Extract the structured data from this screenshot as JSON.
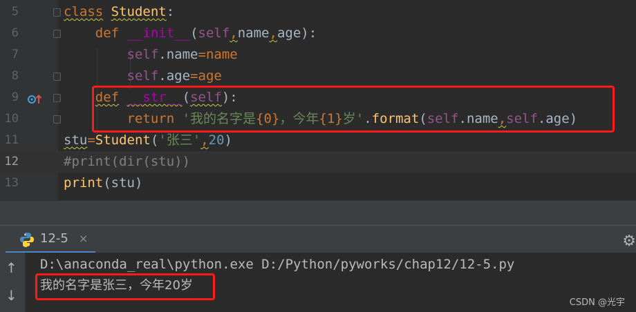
{
  "editor": {
    "line_numbers": [
      "5",
      "6",
      "7",
      "8",
      "9",
      "10",
      "11",
      "12",
      "13"
    ],
    "code": {
      "l5": {
        "kw": "class",
        "name": "Student",
        "colon": ":"
      },
      "l6": {
        "kw": "def",
        "name": "__init__",
        "open": "(",
        "self": "self",
        "c1": ",",
        "p1": "name",
        "c2": ",",
        "p2": "age",
        "close": "):"
      },
      "l7": {
        "self": "self",
        "rest1": ".name",
        "eq": "=",
        "rest2": "name"
      },
      "l8": {
        "self": "self",
        "rest1": ".age",
        "eq": "=",
        "rest2": "age"
      },
      "l9": {
        "kw": "def",
        "name": "__str__",
        "open": "(",
        "self": "self",
        "close": "):"
      },
      "l10": {
        "kw": "return",
        "str1": "'我的名字是",
        "b1": "{0}",
        "str2": "，今年",
        "b2": "{1}",
        "str3": "岁'",
        "dot": ".",
        "fn": "format",
        "open": "(",
        "self1": "self",
        "attr1": ".name",
        "comma": ",",
        "self2": "self",
        "attr2": ".age",
        "close": ")"
      },
      "l11": {
        "var": "stu",
        "eq": "=",
        "cls": "Student",
        "open": "(",
        "str": "'张三'",
        "comma": ",",
        "num": "20",
        "close": ")"
      },
      "l12": {
        "comment": "#print(dir(stu))"
      },
      "l13": {
        "fn": "print",
        "open": "(",
        "arg": "stu",
        "close": ")"
      }
    },
    "current_line": "12"
  },
  "run_panel": {
    "tab_label": "12-5",
    "close_glyph": "×",
    "settings_glyph": "⚙",
    "up_arrow": "↑",
    "down_arrow": "↓",
    "console_lines": [
      "D:\\anaconda_real\\python.exe D:/Python/pyworks/chap12/12-5.py",
      "我的名字是张三，今年20岁"
    ]
  },
  "watermark": "CSDN @光宇",
  "colors": {
    "highlight_border": "#ff1a1a",
    "keyword": "#cc7832",
    "string": "#6a8759",
    "self": "#94558d",
    "dunder": "#b200b2",
    "number": "#6897bb",
    "comment": "#808080"
  }
}
